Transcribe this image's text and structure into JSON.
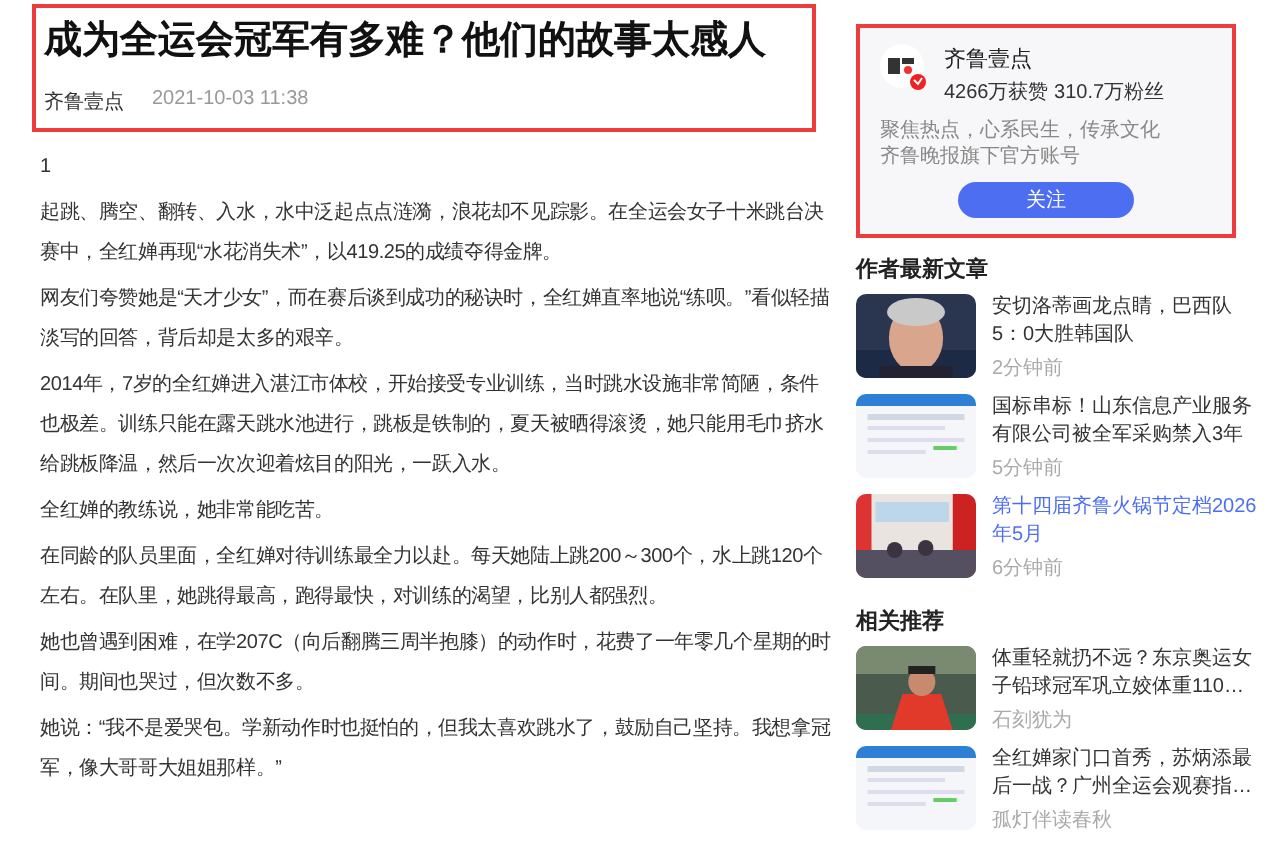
{
  "article": {
    "title": "成为全运会冠军有多难？他们的故事太感人",
    "source": "齐鲁壹点",
    "date": "2021-10-03 11:38",
    "paragraphs": [
      "1",
      "起跳、腾空、翻转、入水，水中泛起点点涟漪，浪花却不见踪影。在全运会女子十米跳台决赛中，全红婵再现“水花消失术”，以419.25的成绩夺得金牌。",
      "网友们夸赞她是“天才少女”，而在赛后谈到成功的秘诀时，全红婵直率地说“练呗。”看似轻描淡写的回答，背后却是太多的艰辛。",
      "2014年，7岁的全红婵进入湛江市体校，开始接受专业训练，当时跳水设施非常简陋，条件也极差。训练只能在露天跳水池进行，跳板是铁制的，夏天被晒得滚烫，她只能用毛巾挤水给跳板降温，然后一次次迎着炫目的阳光，一跃入水。",
      "全红婵的教练说，她非常能吃苦。",
      "在同龄的队员里面，全红婵对待训练最全力以赴。每天她陆上跳200～300个，水上跳120个左右。在队里，她跳得最高，跑得最快，对训练的渴望，比别人都强烈。",
      "她也曾遇到困难，在学207C（向后翻腾三周半抱膝）的动作时，花费了一年零几个星期的时间。期间也哭过，但次数不多。",
      "她说：“我不是爱哭包。学新动作时也挺怕的，但我太喜欢跳水了，鼓励自己坚持。我想拿冠军，像大哥哥大姐姐那样。”"
    ]
  },
  "author_card": {
    "name": "齐鲁壹点",
    "stats": "4266万获赞 310.7万粉丝",
    "description": [
      "聚焦热点，心系民生，传承文化",
      "齐鲁晚报旗下官方账号"
    ],
    "follow_button": "关注"
  },
  "latest_articles": {
    "heading": "作者最新文章",
    "items": [
      {
        "title": "安切洛蒂画龙点睛，巴西队5：0大胜韩国队",
        "meta": "2分钟前",
        "highlighted": false
      },
      {
        "title": "国标串标！山东信息产业服务有限公司被全军采购禁入3年",
        "meta": "5分钟前",
        "highlighted": false
      },
      {
        "title": "第十四届齐鲁火锅节定档2026年5月",
        "meta": "6分钟前",
        "highlighted": true
      }
    ]
  },
  "related": {
    "heading": "相关推荐",
    "items": [
      {
        "title": "体重轻就扔不远？东京奥运女子铅球冠军巩立姣体重110…",
        "meta": "石刻犹为",
        "highlighted": false
      },
      {
        "title": "全红婵家门口首秀，苏炳添最后一战？广州全运会观赛指…",
        "meta": "孤灯伴读春秋",
        "highlighted": false
      }
    ]
  }
}
